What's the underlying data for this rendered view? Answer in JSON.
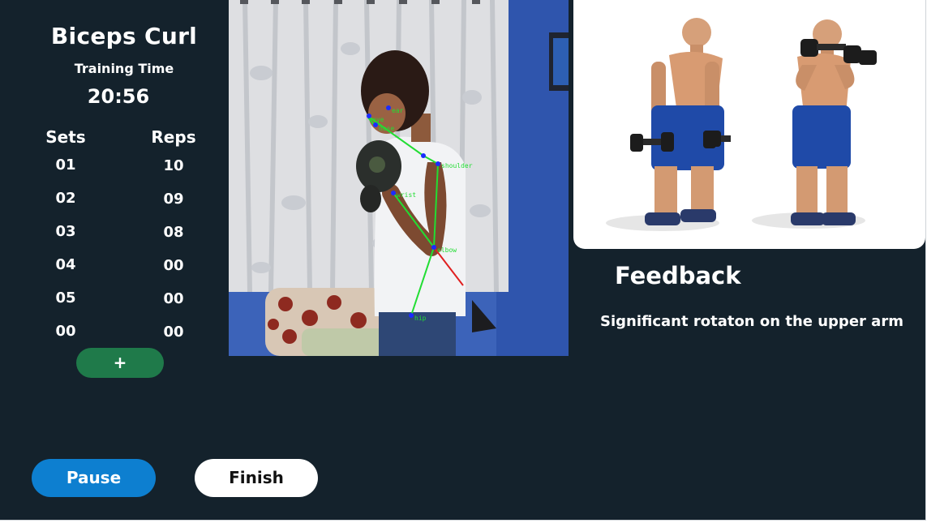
{
  "exercise": {
    "title": "Biceps Curl",
    "training_time_label": "Training Time",
    "training_time": "20:56"
  },
  "table": {
    "headers": {
      "sets": "Sets",
      "reps": "Reps"
    },
    "rows": [
      {
        "set": "01",
        "reps": "10"
      },
      {
        "set": "02",
        "reps": "09"
      },
      {
        "set": "03",
        "reps": "08"
      },
      {
        "set": "04",
        "reps": "00"
      },
      {
        "set": "05",
        "reps": "00"
      },
      {
        "set": "00",
        "reps": "00"
      }
    ]
  },
  "add_button": {
    "label": "+"
  },
  "pose_labels": {
    "ear": "ear",
    "eye": "eye",
    "nose": "nose",
    "shoulder": "shoulder",
    "wrist": "wrist",
    "elbow": "elbow",
    "hip": "hip"
  },
  "feedback": {
    "title": "Feedback",
    "message": "Significant rotaton on the upper arm"
  },
  "controls": {
    "pause_label": "Pause",
    "finish_label": "Finish"
  },
  "colors": {
    "background": "#14222c",
    "pause": "#0d7fd0",
    "add": "#1f7a4a",
    "skeleton": "#22dd33",
    "skeleton_alert": "#e02020",
    "keypoint": "#1a2cff"
  }
}
